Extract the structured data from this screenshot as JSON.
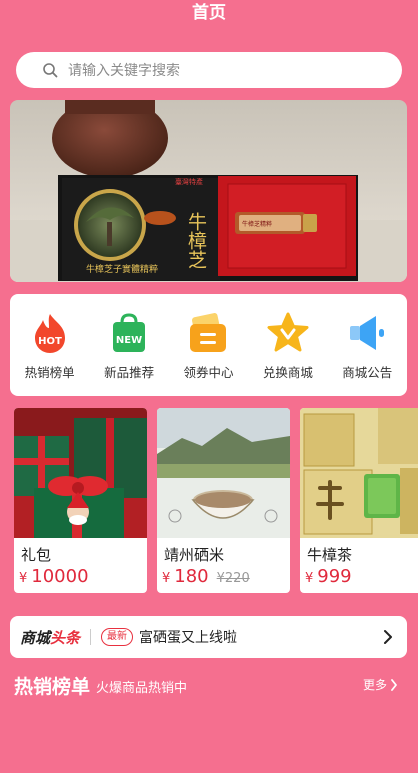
{
  "header": {
    "title": "首页"
  },
  "search": {
    "placeholder": "请输入关键字搜索"
  },
  "banner": {
    "box_title": "牛樟芝",
    "box_badge": "臺灣特產",
    "box_caption": "牛樟芝子實體精粹",
    "vial_label": "牛樟芝精粹"
  },
  "categories": [
    {
      "label": "热销榜单",
      "icon": "hot-flame-icon",
      "icon_text": "HOT",
      "color": "#f2472c"
    },
    {
      "label": "新品推荐",
      "icon": "new-bag-icon",
      "icon_text": "NEW",
      "color": "#2db35a"
    },
    {
      "label": "领券中心",
      "icon": "coupon-icon",
      "color": "#f7a21b"
    },
    {
      "label": "兑换商城",
      "icon": "star-exchange-icon",
      "color": "#f7b51b"
    },
    {
      "label": "商城公告",
      "icon": "megaphone-icon",
      "color": "#3da4f5"
    }
  ],
  "products": [
    {
      "name": "礼包",
      "currency": "¥",
      "price": "10000",
      "old_price": ""
    },
    {
      "name": "靖州硒米",
      "currency": "¥",
      "price": "180",
      "old_price": "¥220"
    },
    {
      "name": "牛樟茶",
      "currency": "¥",
      "price": "999",
      "old_price": ""
    }
  ],
  "headline": {
    "brand_a": "商城",
    "brand_b": "头条",
    "tag": "最新",
    "text": "富硒蛋又上线啦"
  },
  "hot_section": {
    "title": "热销榜单",
    "subtitle": "火爆商品热销中",
    "more": "更多"
  },
  "colors": {
    "background": "#f56f8f",
    "price": "#e0293c"
  }
}
